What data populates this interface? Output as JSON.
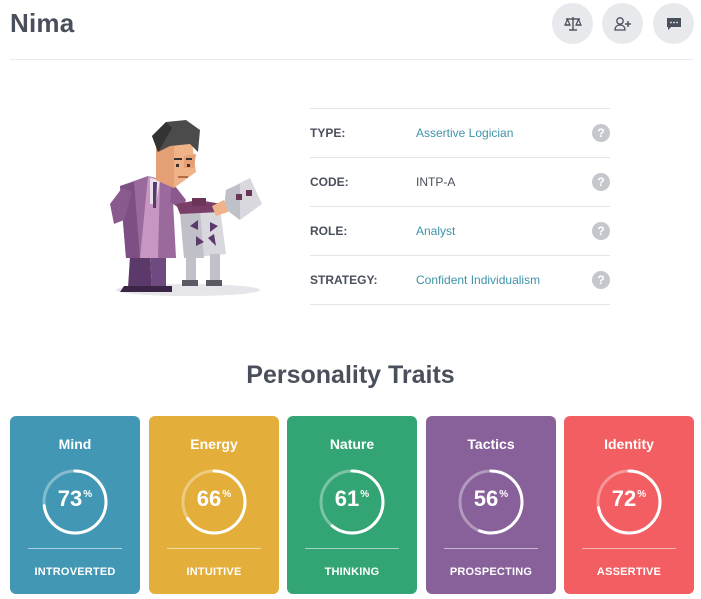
{
  "profile": {
    "name": "Nima",
    "actions": [
      {
        "icon": "compare-scale-icon"
      },
      {
        "icon": "add-friend-icon"
      },
      {
        "icon": "message-icon"
      }
    ]
  },
  "info": [
    {
      "key": "TYPE:",
      "value": "Assertive Logician",
      "link": true
    },
    {
      "key": "CODE:",
      "value": "INTP-A",
      "link": false
    },
    {
      "key": "ROLE:",
      "value": "Analyst",
      "link": true
    },
    {
      "key": "STRATEGY:",
      "value": "Confident Individualism",
      "link": true
    }
  ],
  "help_glyph": "?",
  "traits_title": "Personality Traits",
  "traits": [
    {
      "name": "Mind",
      "percent": 73,
      "percent_sign": "%",
      "label": "INTROVERTED",
      "color": "#4298b4"
    },
    {
      "name": "Energy",
      "percent": 66,
      "percent_sign": "%",
      "label": "INTUITIVE",
      "color": "#e4ae3a"
    },
    {
      "name": "Nature",
      "percent": 61,
      "percent_sign": "%",
      "label": "THINKING",
      "color": "#33a474"
    },
    {
      "name": "Tactics",
      "percent": 56,
      "percent_sign": "%",
      "label": "PROSPECTING",
      "color": "#88619a"
    },
    {
      "name": "Identity",
      "percent": 72,
      "percent_sign": "%",
      "label": "ASSERTIVE",
      "color": "#f25e62"
    }
  ]
}
